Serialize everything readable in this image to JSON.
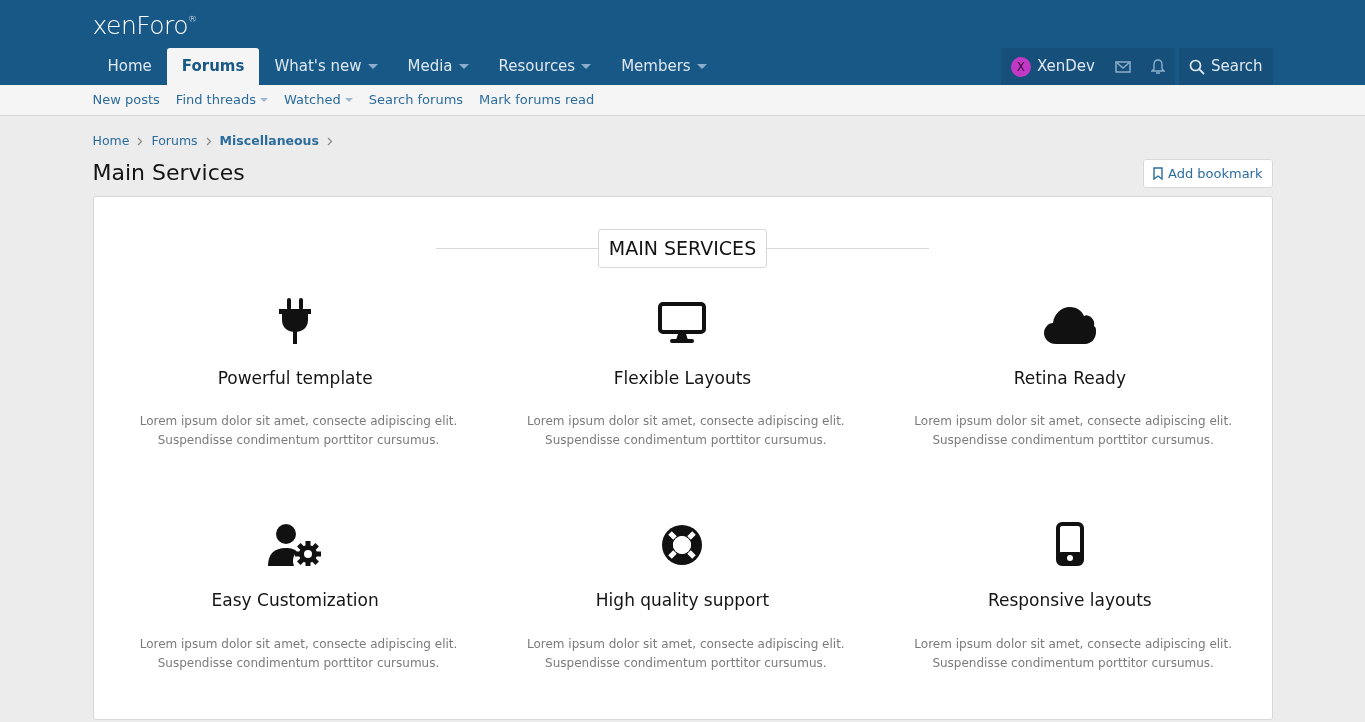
{
  "logo": {
    "text": "xenForo$^{®}$"
  },
  "nav_tabs": [
    {
      "label": "Home",
      "selected": false,
      "has_menu": false
    },
    {
      "label": "Forums",
      "selected": true,
      "has_menu": false
    },
    {
      "label": "What's new",
      "selected": false,
      "has_menu": true
    },
    {
      "label": "Media",
      "selected": false,
      "has_menu": true
    },
    {
      "label": "Resources",
      "selected": false,
      "has_menu": true
    },
    {
      "label": "Members",
      "selected": false,
      "has_menu": true
    }
  ],
  "user": {
    "avatar_letter": "X",
    "name": "XenDev"
  },
  "search": {
    "label": "Search"
  },
  "sub_nav": [
    {
      "label": "New posts",
      "has_menu": false
    },
    {
      "label": "Find threads",
      "has_menu": true
    },
    {
      "label": "Watched",
      "has_menu": true
    },
    {
      "label": "Search forums",
      "has_menu": false
    },
    {
      "label": "Mark forums read",
      "has_menu": false
    }
  ],
  "breadcrumb": [
    {
      "label": "Home",
      "current": false
    },
    {
      "label": "Forums",
      "current": false
    },
    {
      "label": "Miscellaneous",
      "current": true
    }
  ],
  "page_title": "Main Services",
  "bookmark_button": "Add bookmark",
  "section_heading": "MAIN SERVICES",
  "services": [
    {
      "kind": "plug",
      "title": "Powerful template",
      "text": "Lorem ipsum dolor sit amet, consecte adipiscing elit. Suspendisse condimentum porttitor cursumus."
    },
    {
      "kind": "monitor",
      "title": "Flexible Layouts",
      "text": "Lorem ipsum dolor sit amet, consecte adipiscing elit. Suspendisse condimentum porttitor cursumus."
    },
    {
      "kind": "cloud",
      "title": "Retina Ready",
      "text": "Lorem ipsum dolor sit amet, consecte adipiscing elit. Suspendisse condimentum porttitor cursumus."
    },
    {
      "kind": "user-gear",
      "title": "Easy Customization",
      "text": "Lorem ipsum dolor sit amet, consecte adipiscing elit. Suspendisse condimentum porttitor cursumus."
    },
    {
      "kind": "lifebuoy",
      "title": "High quality support",
      "text": "Lorem ipsum dolor sit amet, consecte adipiscing elit. Suspendisse condimentum porttitor cursumus."
    },
    {
      "kind": "phone",
      "title": "Responsive layouts",
      "text": "Lorem ipsum dolor sit amet, consecte adipiscing elit. Suspendisse condimentum porttitor cursumus."
    }
  ]
}
